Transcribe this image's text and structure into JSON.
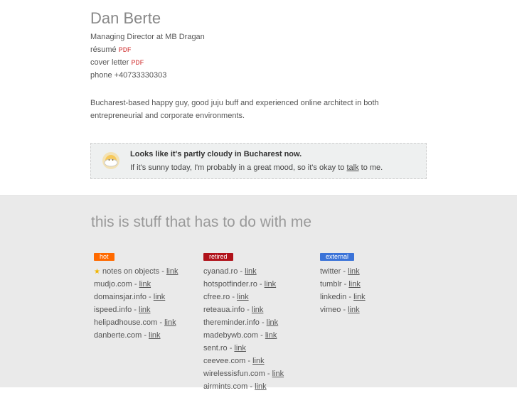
{
  "header": {
    "name": "Dan Berte",
    "role": "Managing Director at MB Dragan",
    "resume_label": "résumé",
    "cover_label": "cover letter",
    "pdf_label": "PDF",
    "phone": "phone +40733330303",
    "intro": "Bucharest-based happy guy, good juju buff and experienced online architect in both entrepreneurial and corporate environments."
  },
  "weather": {
    "title": "Looks like it's partly cloudy in Bucharest now.",
    "text_before": "If it's sunny today, I'm probably in a great mood, so it's okay to ",
    "link": "talk",
    "text_after": " to me.",
    "icon": "partly-cloudy-icon"
  },
  "section_title": "this is stuff that has to do with me",
  "link_label": "link",
  "columns": [
    {
      "badge": "hot",
      "color": "#ff6a00",
      "items": [
        "notes on objects",
        "mudjo.com",
        "domainsjar.info",
        "ispeed.info",
        "helipadhouse.com",
        "danberte.com"
      ]
    },
    {
      "badge": "retired",
      "color": "#b0121a",
      "items": [
        "cyanad.ro",
        "hotspotfinder.ro",
        "cfree.ro",
        "reteaua.info",
        "thereminder.info",
        "madebywb.com",
        "sent.ro",
        "ceevee.com",
        "wirelessisfun.com",
        "airmints.com"
      ]
    },
    {
      "badge": "external",
      "color": "#3b73d8",
      "items": [
        "twitter",
        "tumblr",
        "linkedin",
        "vimeo"
      ]
    }
  ]
}
